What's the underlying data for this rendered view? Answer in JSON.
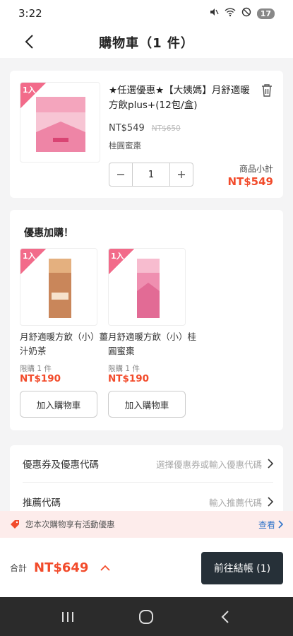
{
  "status_bar": {
    "time": "3:22",
    "battery": "17"
  },
  "header": {
    "title": "購物車（1 件）"
  },
  "cart_item": {
    "badge": "1入",
    "title": "★任選優惠★【大姨媽】月舒適暖方飲plus+(12包/盒)",
    "price": "NT$549",
    "original_price": "NT$650",
    "variant": "桂圓蜜棗",
    "quantity": "1",
    "subtotal_label": "商品小計",
    "subtotal": "NT$549"
  },
  "upsell": {
    "title": "優惠加購！",
    "offers": [
      {
        "badge": "1入",
        "name": "月舒適暖方飲（小）薑汁奶茶",
        "limit": "限購 1 件",
        "price": "NT$190",
        "button": "加入購物車",
        "color": "#c9865a"
      },
      {
        "badge": "1入",
        "name": "月舒適暖方飲（小）桂圓蜜棗",
        "limit": "限購 1 件",
        "price": "NT$190",
        "button": "加入購物車",
        "color": "#ef8fb0"
      }
    ]
  },
  "coupon": {
    "label": "優惠券及優惠代碼",
    "hint": "選擇優惠券或輸入優惠代碼",
    "referral_label": "推薦代碼",
    "referral_hint": "輸入推薦代碼"
  },
  "promo": {
    "text": "您本次購物享有活動優惠",
    "link": "查看"
  },
  "footer": {
    "total_label": "合計",
    "total": "NT$649",
    "checkout": "前往結帳 (1)"
  },
  "colors": {
    "accent": "#f24b2b",
    "badge": "#f26b8a",
    "checkout_bg": "#263038"
  }
}
